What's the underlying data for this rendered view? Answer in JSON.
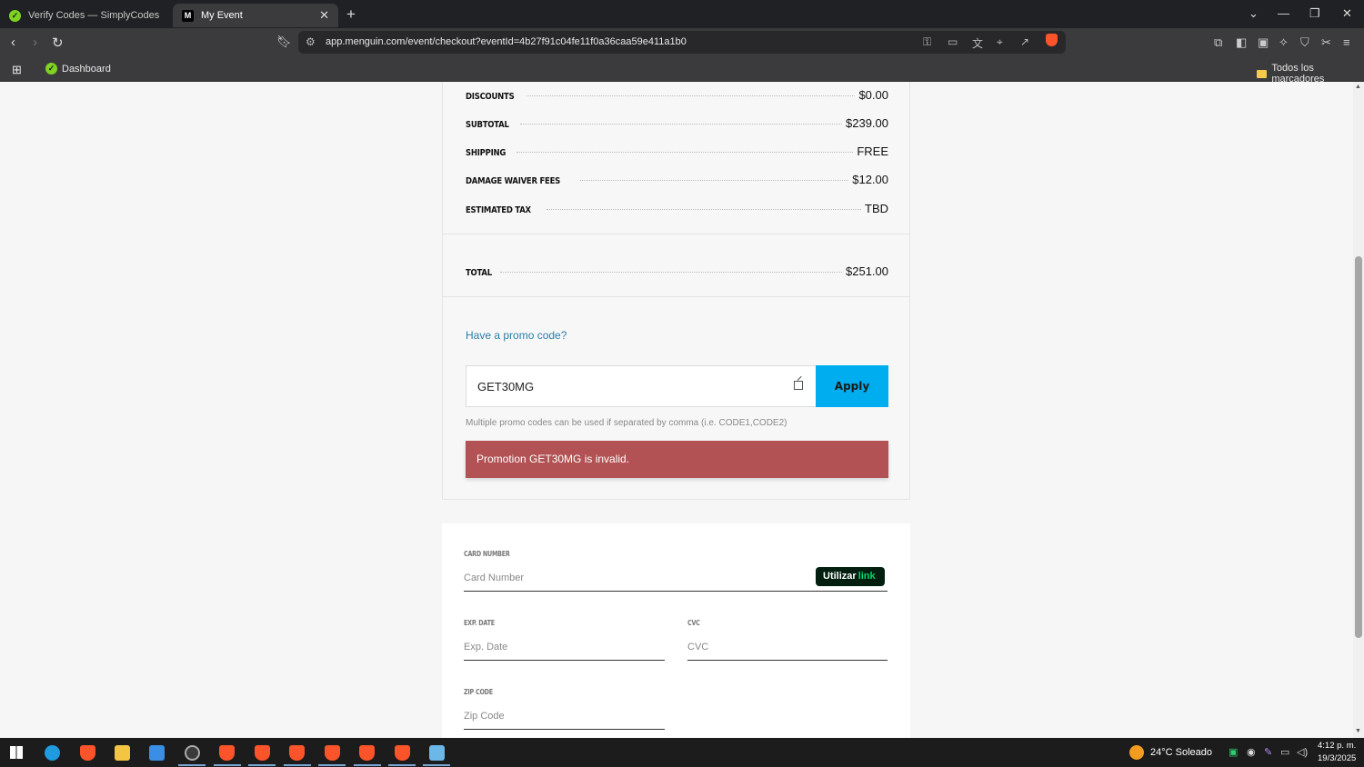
{
  "browser": {
    "tabs": [
      {
        "title": "Verify Codes — SimplyCodes",
        "favicon": "simplycodes-icon",
        "active": false
      },
      {
        "title": "My Event",
        "favicon": "menguin-icon",
        "active": true
      }
    ],
    "url": "app.menguin.com/event/checkout?eventId=4b27f91c04fe11f0a36caa59e411a1b0",
    "bookmarks": [
      {
        "label": "Dashboard"
      },
      {
        "label": "Todos los marcadores"
      }
    ]
  },
  "summary": {
    "rows": [
      {
        "label": "DISCOUNTS",
        "value": "$0.00"
      },
      {
        "label": "SUBTOTAL",
        "value": "$239.00"
      },
      {
        "label": "SHIPPING",
        "value": "FREE"
      },
      {
        "label": "DAMAGE WAIVER FEES",
        "value": "$12.00"
      },
      {
        "label": "ESTIMATED TAX",
        "value": "TBD"
      }
    ],
    "total": {
      "label": "TOTAL",
      "value": "$251.00"
    }
  },
  "promo": {
    "link": "Have a promo code?",
    "value": "GET30MG",
    "apply": "Apply",
    "hint": "Multiple promo codes can be used if separated by comma (i.e. CODE1,CODE2)",
    "error": "Promotion GET30MG is invalid.",
    "error_color": "#b25254",
    "apply_color": "#00adef"
  },
  "payment": {
    "card_label": "CARD NUMBER",
    "card_placeholder": "Card Number",
    "link_btn": {
      "prefix": "Utilizar",
      "brand": "link"
    },
    "exp_label": "EXP. DATE",
    "exp_placeholder": "Exp. Date",
    "cvc_label": "CVC",
    "cvc_placeholder": "CVC",
    "zip_label": "ZIP CODE",
    "zip_placeholder": "Zip Code"
  },
  "taskbar": {
    "weather": "24°C  Soleado",
    "time": "4:12 p. m.",
    "date": "19/3/2025"
  }
}
